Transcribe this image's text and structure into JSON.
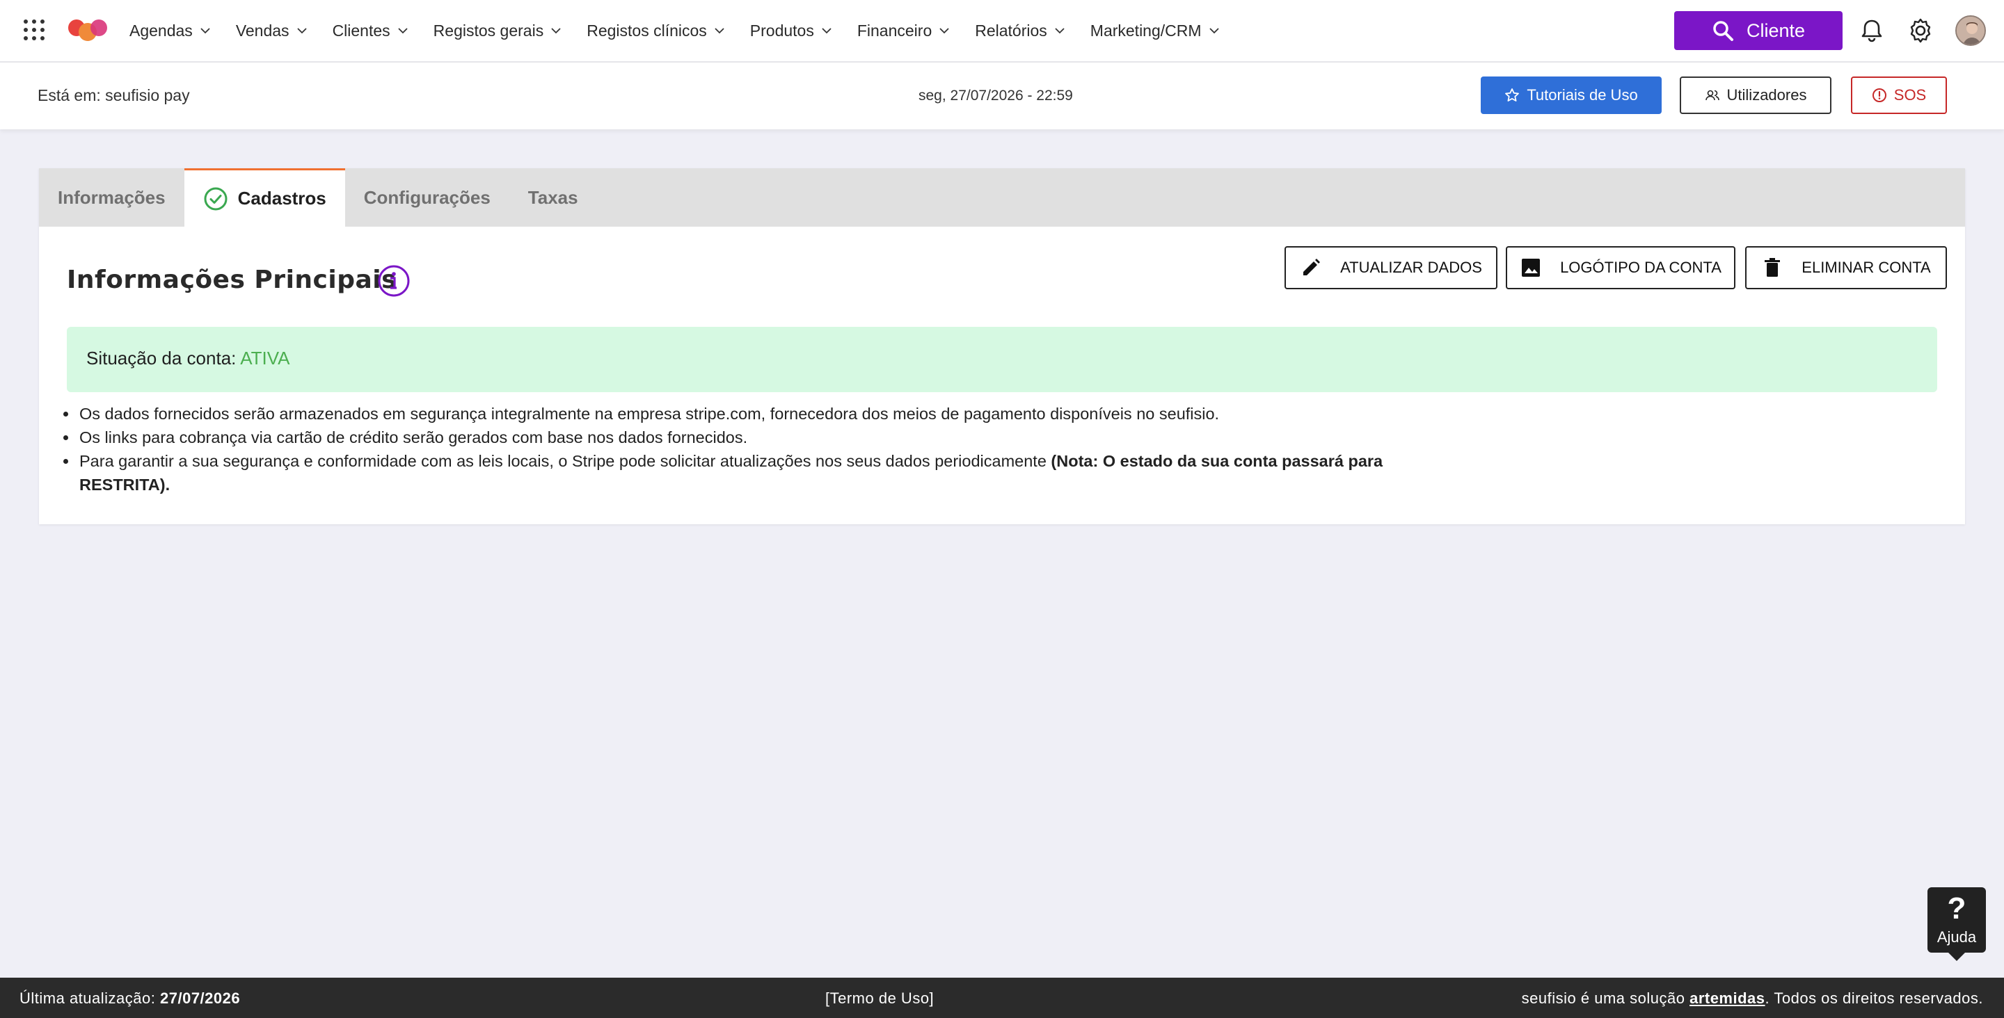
{
  "nav": {
    "items": [
      {
        "label": "Agendas"
      },
      {
        "label": "Vendas"
      },
      {
        "label": "Clientes"
      },
      {
        "label": "Registos gerais"
      },
      {
        "label": "Registos clínicos"
      },
      {
        "label": "Produtos"
      },
      {
        "label": "Financeiro"
      },
      {
        "label": "Relatórios"
      },
      {
        "label": "Marketing/CRM"
      }
    ],
    "client_button": "Cliente"
  },
  "subheader": {
    "location": "Está em: seufisio pay",
    "datetime": "seg, 27/07/2026 - 22:59",
    "tutorials": "Tutoriais de Uso",
    "users": "Utilizadores",
    "sos": "SOS"
  },
  "tabs": [
    {
      "label": "Informações",
      "active": false
    },
    {
      "label": "Cadastros",
      "active": true
    },
    {
      "label": "Configurações",
      "active": false
    },
    {
      "label": "Taxas",
      "active": false
    }
  ],
  "main": {
    "title": "Informações Principais",
    "buttons": {
      "update": "ATUALIZAR DADOS",
      "logo": "LOGÓTIPO DA CONTA",
      "delete": "ELIMINAR CONTA"
    },
    "status_label": "Situação da conta:",
    "status_value": "ATIVA",
    "notes": [
      "Os dados fornecidos serão armazenados em segurança integralmente na empresa stripe.com, fornecedora dos meios de pagamento disponíveis no seufisio.",
      "Os links para cobrança via cartão de crédito serão gerados com base nos dados fornecidos."
    ],
    "note3_text": "Para garantir a sua segurança e conformidade com as leis locais, o Stripe pode solicitar atualizações nos seus dados periodicamente ",
    "note3_bold": "(Nota: O estado da sua conta passará para RESTRITA)."
  },
  "help": {
    "symbol": "?",
    "label": "Ajuda"
  },
  "footer": {
    "updated_label": "Última atualização:",
    "updated_date": "27/07/2026",
    "terms": "[Termo de Uso]",
    "right_prefix": "seufisio é uma solução",
    "brand": "artemidas",
    "right_suffix": ". Todos os direitos reservados."
  },
  "colors": {
    "brand_purple": "#7b16c7",
    "tutorial_blue": "#2f6fd8",
    "sos_red": "#c62828",
    "status_green": "#4caf50",
    "status_bg": "#d6f9e2",
    "tab_accent": "#f07030"
  }
}
